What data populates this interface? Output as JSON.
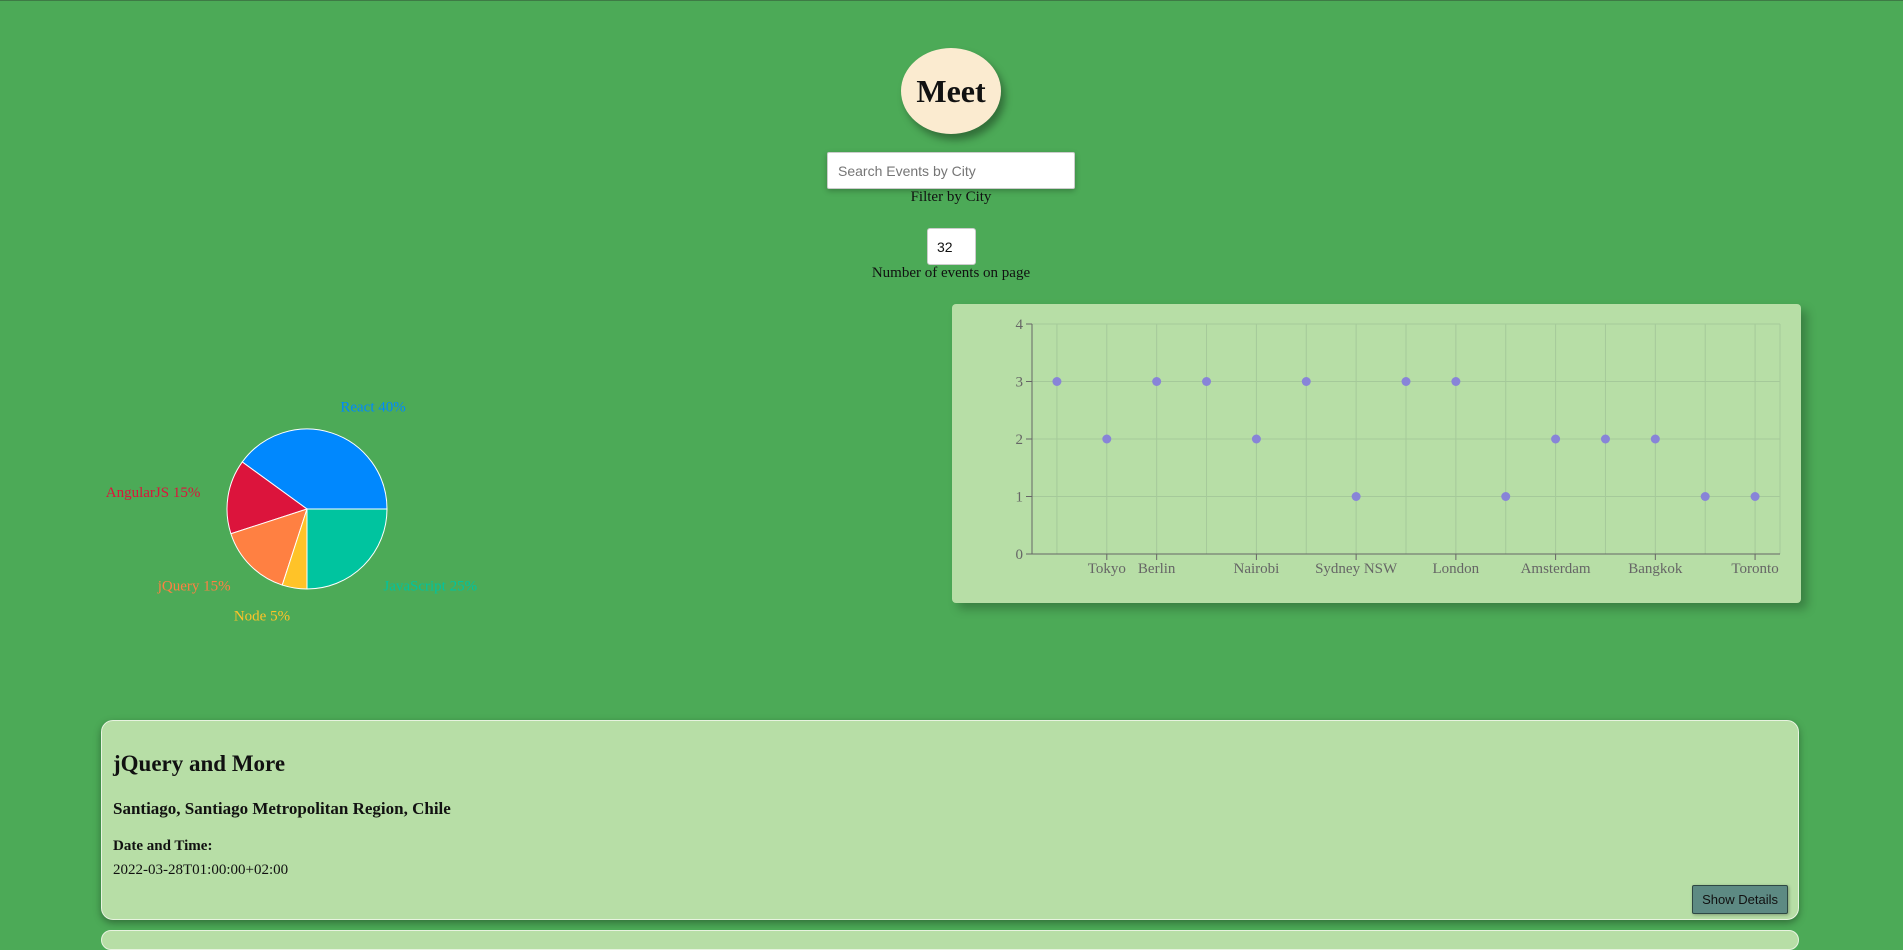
{
  "app": {
    "logo_text": "Meet"
  },
  "search": {
    "placeholder": "Search Events by City",
    "value": "",
    "label": "Filter by City"
  },
  "number_events": {
    "value": "32",
    "label": "Number of events on page"
  },
  "chart_data": [
    {
      "type": "pie",
      "categories": [
        "React",
        "AngularJS",
        "jQuery",
        "Node",
        "JavaScript"
      ],
      "values": [
        40,
        15,
        15,
        5,
        25
      ],
      "labels": [
        "React 40%",
        "AngularJS 15%",
        "jQuery 15%",
        "Node 5%",
        "JavaScript 25%"
      ],
      "colors": [
        "#0088fe",
        "#dc143c",
        "#ff8042",
        "#ffc328",
        "#00c49f"
      ],
      "title": ""
    },
    {
      "type": "scatter",
      "x": [
        "",
        "Tokyo",
        "Berlin",
        "",
        "Nairobi",
        "",
        "Sydney NSW",
        "",
        "London",
        "",
        "Amsterdam",
        "",
        "Bangkok",
        "",
        "Toronto"
      ],
      "y": [
        3,
        2,
        3,
        3,
        2,
        3,
        1,
        3,
        3,
        1,
        2,
        2,
        2,
        1,
        1
      ],
      "tick_labels": [
        "Tokyo",
        "Berlin",
        "Nairobi",
        "Sydney NSW",
        "London",
        "Amsterdam",
        "Bangkok",
        "Toronto"
      ],
      "y_ticks": [
        "0",
        "1",
        "2",
        "3",
        "4"
      ],
      "ylim": [
        0,
        4
      ],
      "grid": true,
      "point_color": "#8884d8",
      "xlabel": "",
      "ylabel": "",
      "title": ""
    }
  ],
  "events": [
    {
      "title": "jQuery and More",
      "location": "Santiago, Santiago Metropolitan Region, Chile",
      "datetime_label": "Date and Time:",
      "datetime": "2022-03-28T01:00:00+02:00",
      "details_button": "Show Details"
    }
  ]
}
